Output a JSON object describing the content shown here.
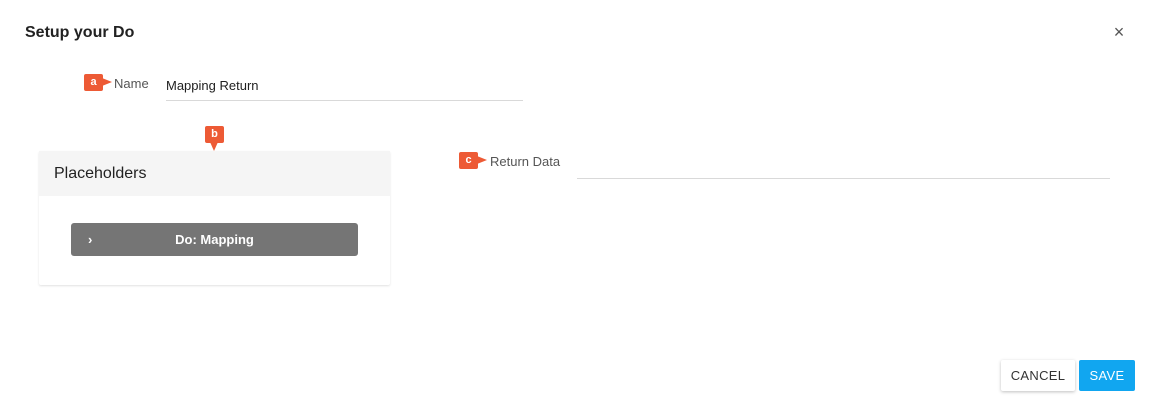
{
  "dialog": {
    "title": "Setup your Do",
    "close_glyph": "×"
  },
  "badges": {
    "a": "a",
    "b": "b",
    "c": "c"
  },
  "name_field": {
    "label": "Name",
    "value": "Mapping Return"
  },
  "placeholders": {
    "header": "Placeholders",
    "items": [
      {
        "label": "Do: Mapping",
        "icon": "chevron-right-icon",
        "glyph": "›"
      }
    ]
  },
  "return_data": {
    "label": "Return Data",
    "value": ""
  },
  "actions": {
    "cancel_label": "CANCEL",
    "save_label": "SAVE"
  },
  "colors": {
    "badge": "#ed5a35",
    "save": "#11a6f0",
    "placeholder_button": "#757575"
  }
}
